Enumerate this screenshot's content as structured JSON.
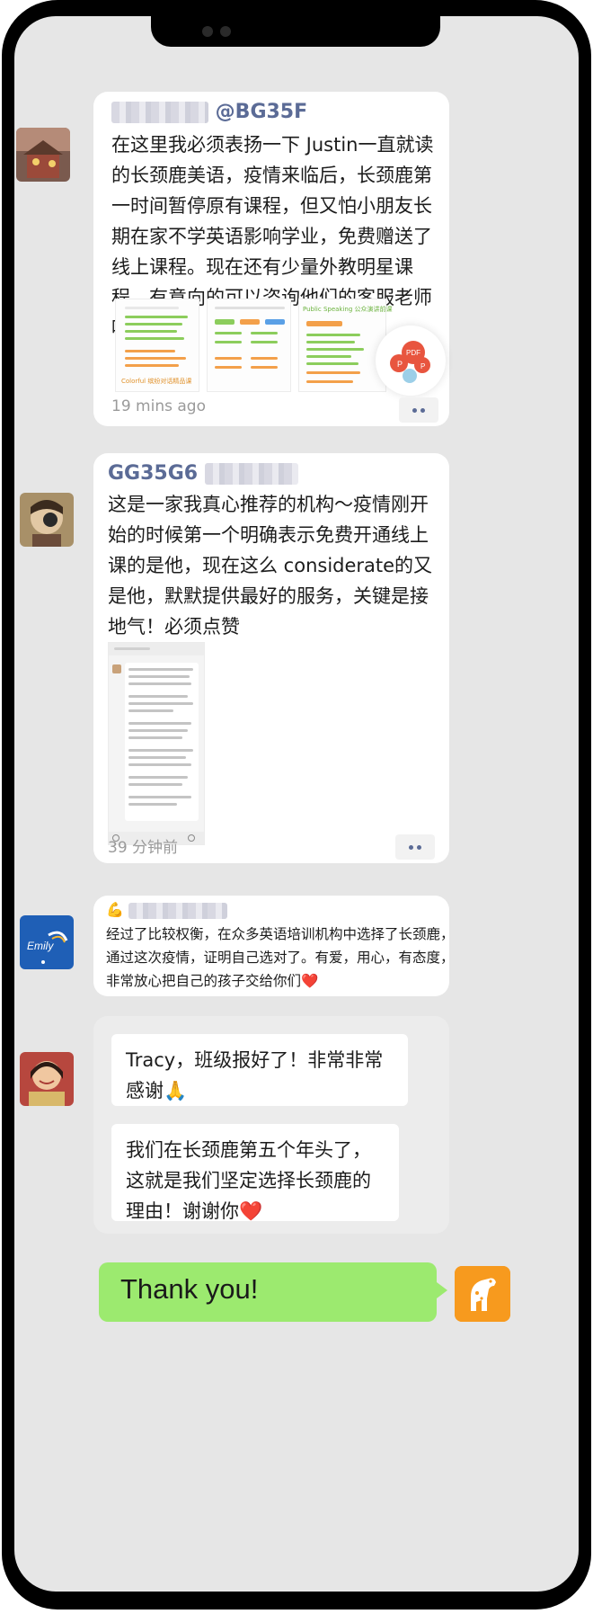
{
  "posts": [
    {
      "handle": "@BG35F",
      "text_lines": [
        "在这里我必须表扬一下 Justin一直就读",
        "的长颈鹿美语，疫情来临后，长颈鹿第",
        "一时间暂停原有课程，但又怕小朋友长",
        "期在家不学英语影响学业，免费赠送了",
        "线上课程。现在还有少量外教明星课",
        "程，有意向的可以咨询他们的客服老师",
        "呢！"
      ],
      "attachment_captions": [
        "Colorful 缤纷对话精品课",
        "Public Speaking 公众演讲前课"
      ],
      "pdf_badge": "PDF",
      "time": "19 mins ago"
    },
    {
      "handle": "GG35G6",
      "text_lines": [
        "这是一家我真心推荐的机构～疫情刚开",
        "始的时候第一个明确表示免费开通线上",
        "课的是他，现在这么 considerate的又",
        "是他，默默提供最好的服务，关键是接",
        "地气！必须点赞"
      ],
      "time": "39 分钟前"
    },
    {
      "text_lines": [
        "经过了比较权衡，在众多英语培训机构中选择了长颈鹿，",
        "通过这次疫情，证明自己选对了。有爱，用心，有态度，",
        "非常放心把自己的孩子交给你们❤️"
      ],
      "avatar_text": "Emily"
    },
    {
      "bubbles": [
        [
          "Tracy，班级报好了！非常非常",
          "感谢🙏"
        ],
        [
          "我们在长颈鹿第五个年头了，",
          "这就是我们坚定选择长颈鹿的",
          "理由！谢谢你❤️"
        ]
      ]
    }
  ],
  "reply": {
    "text": "Thank you!"
  },
  "colors": {
    "green": "#9cea6f",
    "brand_orange": "#f79a1e",
    "handle_blue": "#5b6b96"
  }
}
